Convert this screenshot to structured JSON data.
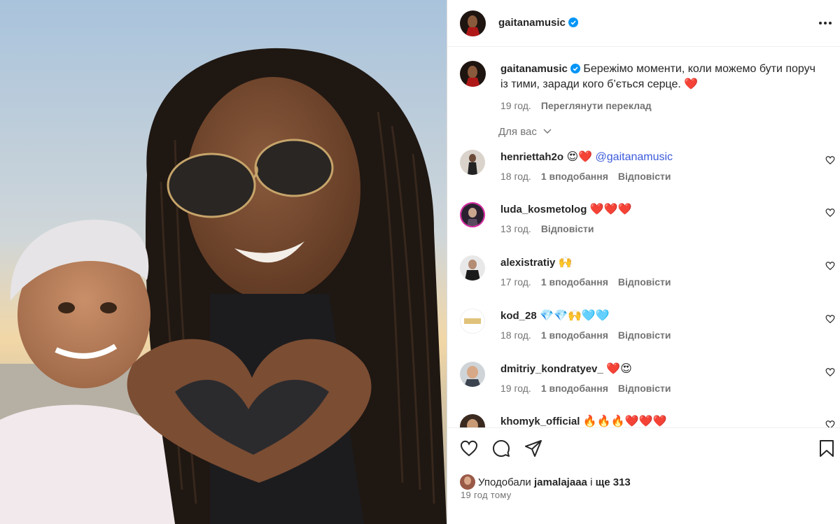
{
  "post": {
    "username": "gaitanamusic",
    "caption": "Бережімо моменти, коли можемо бути поруч із тими, заради кого б’ється серце. ❤️",
    "caption_time": "19 год.",
    "translate_label": "Переглянути переклад",
    "for_you_label": "Для вас"
  },
  "comments": [
    {
      "username": "henriettah2o",
      "text": "😍❤️",
      "mention": "@gaitanamusic",
      "time": "18 год.",
      "likes": "1 вподобання",
      "reply": "Відповісти"
    },
    {
      "username": "luda_kosmetolog",
      "text": "❤️❤️❤️",
      "mention": "",
      "time": "13 год.",
      "likes": "",
      "reply": "Відповісти"
    },
    {
      "username": "alexistratiy",
      "text": "🙌",
      "mention": "",
      "time": "17 год.",
      "likes": "1 вподобання",
      "reply": "Відповісти"
    },
    {
      "username": "kod_28",
      "text": "💎💎🙌🩵🩵",
      "mention": "",
      "time": "18 год.",
      "likes": "1 вподобання",
      "reply": "Відповісти"
    },
    {
      "username": "dmitriy_kondratyev_",
      "text": "❤️😍",
      "mention": "",
      "time": "19 год.",
      "likes": "1 вподобання",
      "reply": "Відповісти"
    },
    {
      "username": "khomyk_official",
      "text": "🔥🔥🔥❤️❤️❤️",
      "mention": "",
      "time": "",
      "likes": "",
      "reply": ""
    }
  ],
  "footer": {
    "liked_prefix": "Уподобали",
    "liked_user": "jamalajaaa",
    "liked_mid": "і",
    "liked_count": "ще 313",
    "posted_ago": "19 год тому"
  },
  "icons": {
    "verified": "verified-badge-icon",
    "more": "more-options-icon",
    "like": "heart-icon",
    "comment": "comment-icon",
    "share": "share-icon",
    "save": "bookmark-icon",
    "for_you_chevron": "chevron-down-icon"
  },
  "colors": {
    "verified": "#0095f6",
    "secondary_text": "#737373",
    "mention": "#3b5bdb"
  }
}
